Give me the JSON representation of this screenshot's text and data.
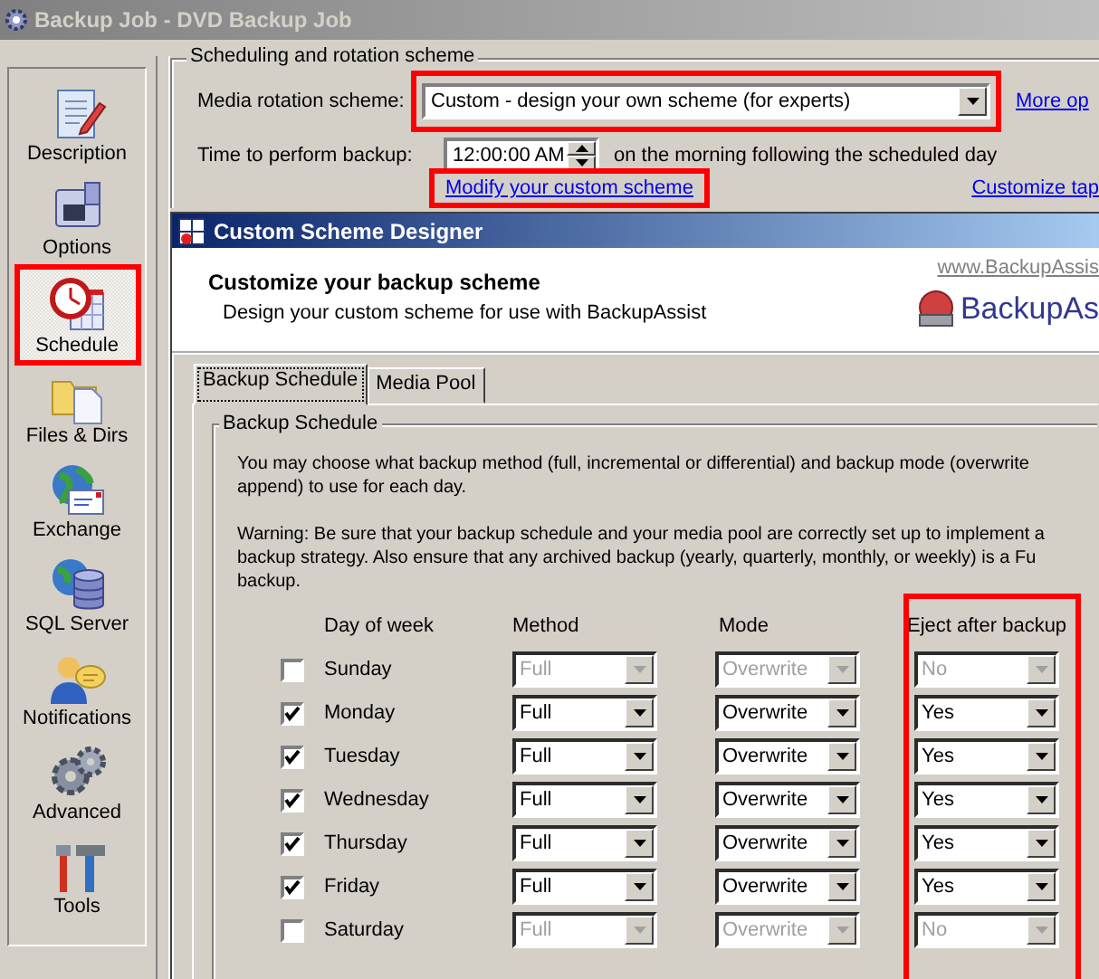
{
  "window": {
    "title": "Backup Job - DVD Backup Job"
  },
  "sidebar": {
    "items": [
      {
        "label": "Description",
        "kind": "description",
        "selected": false,
        "highlighted": false
      },
      {
        "label": "Options",
        "kind": "options",
        "selected": false,
        "highlighted": false
      },
      {
        "label": "Schedule",
        "kind": "schedule",
        "selected": true,
        "highlighted": true
      },
      {
        "label": "Files & Dirs",
        "kind": "files",
        "selected": false,
        "highlighted": false
      },
      {
        "label": "Exchange",
        "kind": "exchange",
        "selected": false,
        "highlighted": false
      },
      {
        "label": "SQL Server",
        "kind": "sql",
        "selected": false,
        "highlighted": false
      },
      {
        "label": "Notifications",
        "kind": "notifications",
        "selected": false,
        "highlighted": false
      },
      {
        "label": "Advanced",
        "kind": "advanced",
        "selected": false,
        "highlighted": false
      },
      {
        "label": "Tools",
        "kind": "tools",
        "selected": false,
        "highlighted": false
      }
    ]
  },
  "scheduling": {
    "title": "Scheduling and rotation scheme",
    "rotation": {
      "label": "Media rotation scheme:",
      "value": "Custom - design your own scheme (for experts)",
      "highlighted": true
    },
    "more_link": "More op",
    "time": {
      "label": "Time to perform backup:",
      "value": "12:00:00 AM",
      "note": "on the morning following the scheduled day"
    },
    "modify_link": {
      "text": "Modify your custom scheme",
      "highlighted": true
    },
    "customize_link": "Customize tap"
  },
  "dialog": {
    "title": "Custom Scheme Designer",
    "heading": "Customize your backup scheme",
    "subheading": "Design your custom scheme for use with BackupAssist",
    "website": "www.BackupAssis",
    "logo_text": "BackupAs",
    "tabs": [
      {
        "label": "Backup Schedule",
        "selected": true
      },
      {
        "label": "Media Pool",
        "selected": false
      }
    ],
    "group_title": "Backup Schedule",
    "paragraphs": [
      [
        "You may choose what backup method (full, incremental or differential) and backup mode (overwrite",
        "append) to use for each day."
      ],
      [
        "Warning: Be sure that your backup schedule and your media pool are correctly set up to implement a",
        "backup strategy. Also ensure that any archived backup (yearly, quarterly, monthly, or weekly) is a Fu",
        "backup."
      ]
    ],
    "columns": [
      "Day of week",
      "Method",
      "Mode",
      "Eject after backup"
    ],
    "eject_highlighted": true,
    "rows": [
      {
        "day": "Sunday",
        "checked": false,
        "method": "Full",
        "mode": "Overwrite",
        "eject": "No"
      },
      {
        "day": "Monday",
        "checked": true,
        "method": "Full",
        "mode": "Overwrite",
        "eject": "Yes"
      },
      {
        "day": "Tuesday",
        "checked": true,
        "method": "Full",
        "mode": "Overwrite",
        "eject": "Yes"
      },
      {
        "day": "Wednesday",
        "checked": true,
        "method": "Full",
        "mode": "Overwrite",
        "eject": "Yes"
      },
      {
        "day": "Thursday",
        "checked": true,
        "method": "Full",
        "mode": "Overwrite",
        "eject": "Yes"
      },
      {
        "day": "Friday",
        "checked": true,
        "method": "Full",
        "mode": "Overwrite",
        "eject": "Yes"
      },
      {
        "day": "Saturday",
        "checked": false,
        "method": "Full",
        "mode": "Overwrite",
        "eject": "No"
      }
    ]
  }
}
